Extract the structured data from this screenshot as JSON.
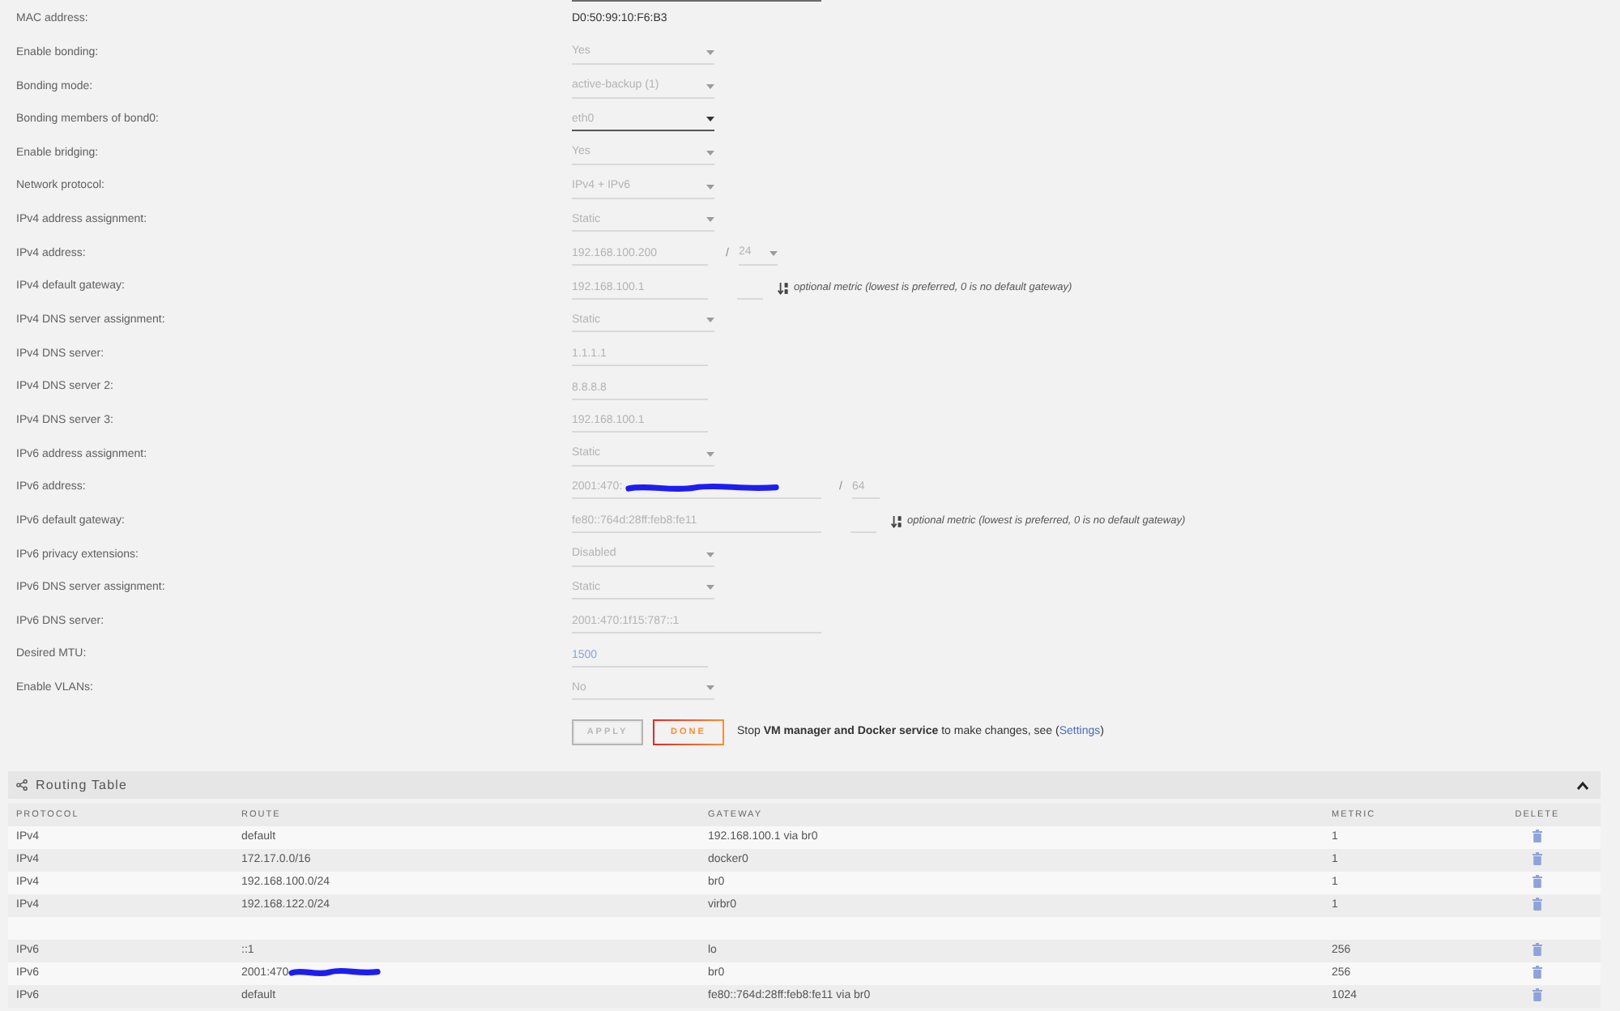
{
  "form": {
    "rows": [
      {
        "label": "MAC address:",
        "kind": "static",
        "value": "D0:50:99:10:F6:B3"
      },
      {
        "label": "Enable bonding:",
        "kind": "select",
        "value": "Yes",
        "disabled": true
      },
      {
        "label": "Bonding mode:",
        "kind": "select",
        "value": "active-backup (1)",
        "disabled": true
      },
      {
        "label": "Bonding members of bond0:",
        "kind": "select",
        "value": "eth0",
        "disabled": false
      },
      {
        "label": "Enable bridging:",
        "kind": "select",
        "value": "Yes",
        "disabled": true
      },
      {
        "label": "Network protocol:",
        "kind": "select",
        "value": "IPv4 + IPv6",
        "disabled": true
      },
      {
        "label": "IPv4 address assignment:",
        "kind": "select",
        "value": "Static",
        "disabled": true
      },
      {
        "label": "IPv4 address:",
        "kind": "text",
        "value": "192.168.100.200",
        "disabled": true,
        "suffix": {
          "separator": "/",
          "kind": "select",
          "value": "24",
          "disabled": true
        }
      },
      {
        "label": "IPv4 default gateway:",
        "kind": "text",
        "value": "192.168.100.1",
        "disabled": true,
        "metric": {
          "hint": "optional metric (lowest is preferred, 0 is no default gateway)"
        }
      },
      {
        "label": "IPv4 DNS server assignment:",
        "kind": "select",
        "value": "Static",
        "disabled": true
      },
      {
        "label": "IPv4 DNS server:",
        "kind": "text",
        "value": "1.1.1.1",
        "disabled": true
      },
      {
        "label": "IPv4 DNS server 2:",
        "kind": "text",
        "value": "8.8.8.8",
        "disabled": true
      },
      {
        "label": "IPv4 DNS server 3:",
        "kind": "text",
        "value": "192.168.100.1",
        "disabled": true
      },
      {
        "label": "IPv6 address assignment:",
        "kind": "select",
        "value": "Static",
        "disabled": true
      },
      {
        "label": "IPv6 address:",
        "kind": "ipv6_text",
        "value": "2001:470:",
        "redacted": true,
        "disabled": true,
        "suffix": {
          "separator": "/",
          "kind": "text",
          "value": "64",
          "disabled": true
        }
      },
      {
        "label": "IPv6 default gateway:",
        "kind": "ipv6_text",
        "value": "fe80::764d:28ff:feb8:fe11",
        "disabled": true,
        "metric": {
          "hint": "optional metric (lowest is preferred, 0 is no default gateway)"
        }
      },
      {
        "label": "IPv6 privacy extensions:",
        "kind": "select",
        "value": "Disabled",
        "disabled": true
      },
      {
        "label": "IPv6 DNS server assignment:",
        "kind": "select",
        "value": "Static",
        "disabled": true
      },
      {
        "label": "IPv6 DNS server:",
        "kind": "ipv6_text",
        "value": "2001:470:1f15:787::1",
        "disabled": true
      },
      {
        "label": "Desired MTU:",
        "kind": "text",
        "placeholder": "1500",
        "disabled": true
      },
      {
        "label": "Enable VLANs:",
        "kind": "select",
        "value": "No",
        "disabled": true
      }
    ]
  },
  "actions": {
    "buttons": [
      {
        "label": "APPLY",
        "disabled": true
      },
      {
        "label": "DONE",
        "disabled": false
      }
    ],
    "notice": {
      "text": "Stop **VM manager and Docker service** to make changes, see (",
      "link": "Settings",
      "text_after": ")"
    }
  },
  "routing_table": {
    "title": "Routing Table",
    "expanded": true,
    "columns": [
      "PROTOCOL",
      "ROUTE",
      "GATEWAY",
      "METRIC",
      "DELETE"
    ],
    "groups": [
      {
        "rows": [
          {
            "protocol": "IPv4",
            "route": "default",
            "gateway": "192.168.100.1 via br0",
            "metric": "1"
          },
          {
            "protocol": "IPv4",
            "route": "172.17.0.0/16",
            "gateway": "docker0",
            "metric": "1"
          },
          {
            "protocol": "IPv4",
            "route": "192.168.100.0/24",
            "gateway": "br0",
            "metric": "1"
          },
          {
            "protocol": "IPv4",
            "route": "192.168.122.0/24",
            "gateway": "virbr0",
            "metric": "1"
          }
        ]
      },
      {
        "rows": [
          {
            "protocol": "IPv6",
            "route": "::1",
            "gateway": "lo",
            "metric": "256"
          },
          {
            "protocol": "IPv6",
            "route": "2001:470",
            "redacted": true,
            "gateway": "br0",
            "metric": "256"
          },
          {
            "protocol": "IPv6",
            "route": "default",
            "gateway": "fe80::764d:28ff:feb8:fe11 via br0",
            "metric": "1024"
          }
        ]
      }
    ]
  }
}
